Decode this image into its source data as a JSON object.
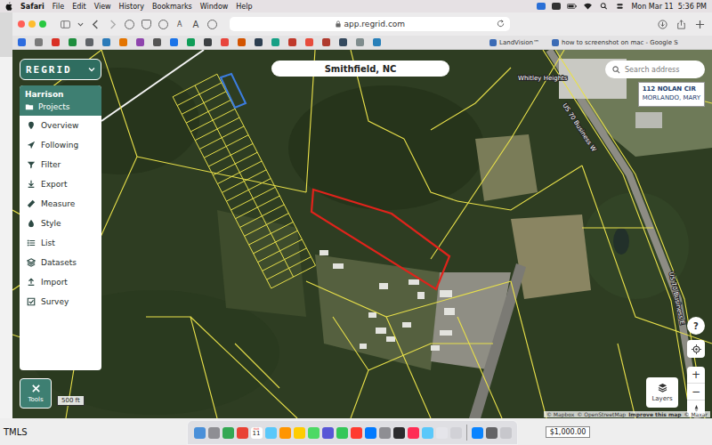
{
  "menubar": {
    "app": "Safari",
    "menus": [
      "File",
      "Edit",
      "View",
      "History",
      "Bookmarks",
      "Window",
      "Help"
    ],
    "clock": "Mon Mar 11  5:36 PM"
  },
  "browser": {
    "font_buttons": [
      "A",
      "A"
    ],
    "address": "app.regrid.com",
    "bookmarks": [
      "LandVision™",
      "how to screenshot on mac - Google S"
    ]
  },
  "sidebar": {
    "logo": "REGRID",
    "account": "Harrison",
    "section": "Projects",
    "items": [
      {
        "label": "Overview"
      },
      {
        "label": "Following"
      },
      {
        "label": "Filter"
      },
      {
        "label": "Export"
      },
      {
        "label": "Measure"
      },
      {
        "label": "Style"
      },
      {
        "label": "List"
      },
      {
        "label": "Datasets"
      },
      {
        "label": "Import"
      },
      {
        "label": "Survey"
      }
    ],
    "tools": "Tools"
  },
  "map": {
    "place": "Smithfield, NC",
    "search_placeholder": "Search address",
    "parcel_card": {
      "address": "112 NOLAN CIR",
      "owner": "MORLANDO, MARY"
    },
    "labels": [
      "Whitley Heights",
      "US 70 Business W",
      "US 70 Business E"
    ],
    "scale": "500 ft",
    "help": "?",
    "zoom_in": "+",
    "zoom_out": "−",
    "layers": "Layers",
    "attribution": [
      "© Mapbox",
      "© OpenStreetMap",
      "Improve this map",
      "© Maxar"
    ]
  },
  "desktop": {
    "left_label": "TMLS",
    "amount": "$1,000.00"
  },
  "dock": {
    "calendar_month": "MAR",
    "calendar_day": "11"
  }
}
